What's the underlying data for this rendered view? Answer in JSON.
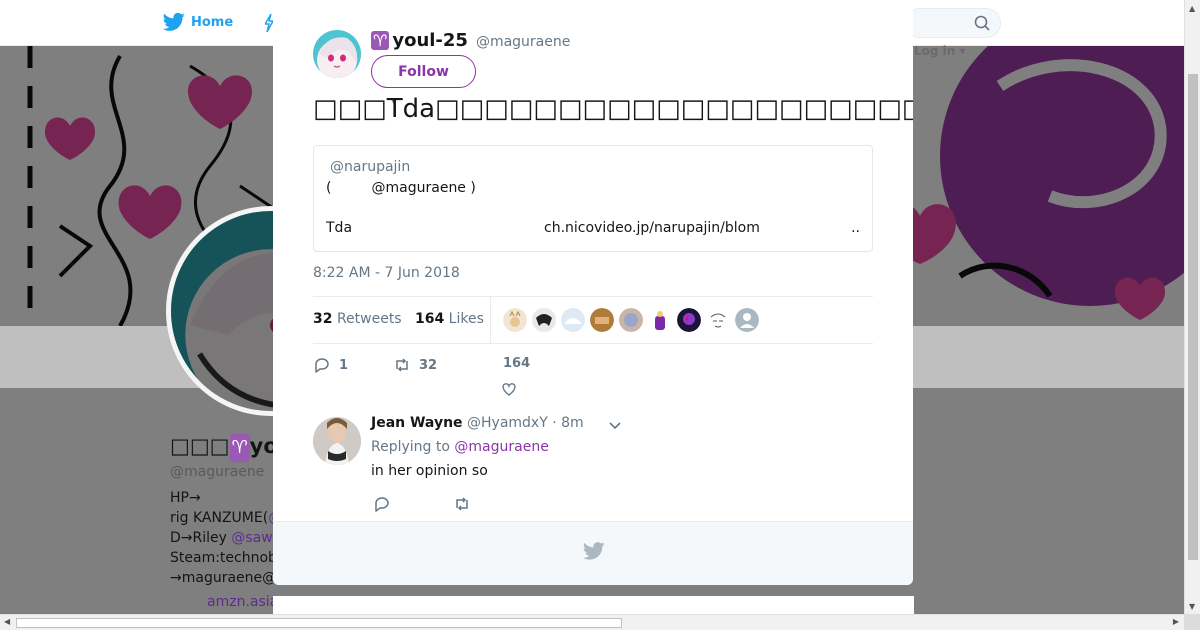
{
  "nav": {
    "home_label": "Home",
    "login_label": "Log in ▾"
  },
  "profile": {
    "name_prefix": "□□□",
    "name_symbol": "♈",
    "name_rest": "you",
    "handle": "@maguraene",
    "bio_lines": [
      "HP→",
      "rig KANZUME(",
      "D→Riley ",
      "Steam:technob",
      "→maguraene@gmail.com "
    ],
    "bio_link_1": "@",
    "bio_link_2": "@saw",
    "amzn_link": "amzn.asia"
  },
  "tweet": {
    "symbol": "♈",
    "display_name": "youl-25",
    "screen_name": "@maguraene",
    "follow_label": "Follow",
    "text": "□□□Tda□□□□□□□□□□□□□□□□□□□□□□□□□□□□□□□□□□□□Riley□□□□□□□□□□□□□□□□□□□□□",
    "quote": {
      "user": "@narupajin",
      "line1": "(         @maguraene )",
      "line2_left": "Tda",
      "line2_link": "ch.nicovideo.jp/narupajin/blom",
      "line2_more": ".."
    },
    "timestamp": "8:22 AM - 7 Jun 2018",
    "retweets": "32",
    "retweets_label": "Retweets",
    "likes": "164",
    "likes_label": "Likes",
    "actions": {
      "reply_count": "1",
      "retweet_count": "32",
      "like_count": "164"
    }
  },
  "reply": {
    "name": "Jean Wayne",
    "handle": "@HyamdxY",
    "time": "· 8m",
    "replying_prefix": "Replying to",
    "replying_to": "@maguraene",
    "text": "in her opinion so"
  },
  "colors": {
    "accent": "#8b35a8",
    "twitter_blue": "#1da1f2",
    "muted": "#657786"
  }
}
